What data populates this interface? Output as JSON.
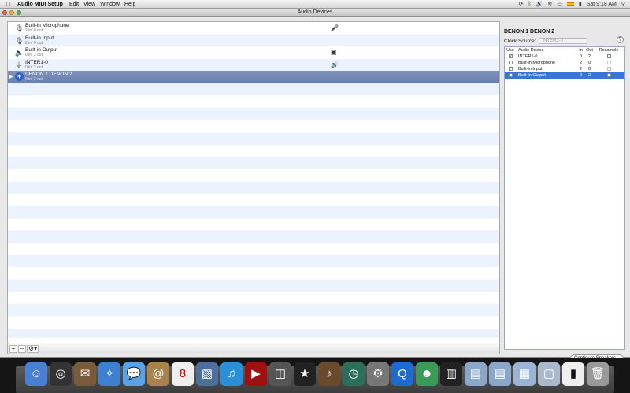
{
  "menubar": {
    "app_name": "Audio MIDI Setup",
    "menus": [
      "Edit",
      "View",
      "Window",
      "Help"
    ],
    "clock": "Sat 9:18 AM"
  },
  "window": {
    "title": "Audio Devices"
  },
  "devices": [
    {
      "name": "Built-in Microphone",
      "io": "2 in/ 0 out",
      "icon": "microphone-device-icon",
      "activity": "microphone-icon"
    },
    {
      "name": "Built-in Input",
      "io": "2 in/ 0 out",
      "icon": "microphone-device-icon",
      "activity": ""
    },
    {
      "name": "Built-in Output",
      "io": "0 in/ 2 out",
      "icon": "speaker-device-icon",
      "activity": "screen-icon"
    },
    {
      "name": "INTER1-0",
      "io": "0 in/ 2 out",
      "icon": "usb-device-icon",
      "activity": "speaker-icon"
    },
    {
      "name": "DENON 1 DENON 2",
      "io": "0 in/ 2 out",
      "icon": "aggregate-device-icon",
      "activity": ""
    }
  ],
  "footer": {
    "add": "+",
    "remove": "−",
    "gear": "⚙▾"
  },
  "detail": {
    "device_name": "DENON 1 DENON 2",
    "clock_source_label": "Clock Source:",
    "clock_source_value": "INTER1-0",
    "help": "?",
    "columns": [
      "Use",
      "Audio Device",
      "In",
      "Out",
      "Resample"
    ],
    "rows": [
      {
        "use": true,
        "device": "INTER1-0",
        "in": "0",
        "out": "2",
        "resample": false
      },
      {
        "use": false,
        "device": "Built-in Microphone",
        "in": "2",
        "out": "0",
        "resample": false
      },
      {
        "use": false,
        "device": "Built-in Input",
        "in": "2",
        "out": "0",
        "resample": false
      },
      {
        "use": false,
        "device": "Built-in Output",
        "in": "0",
        "out": "2",
        "resample": false
      }
    ],
    "configure_button": "Configure Speakers..."
  },
  "dock": {
    "items": [
      "finder-icon",
      "dashboard-icon",
      "mail-icon",
      "safari-icon",
      "ichat-icon",
      "address-book-icon",
      "ical-icon",
      "iphoto-icon",
      "itunes-icon",
      "dvd-player-icon",
      "photo-booth-icon",
      "imovie-icon",
      "garageband-icon",
      "time-machine-icon",
      "system-preferences-icon",
      "quicktime-icon",
      "messenger-icon",
      "piano-icon",
      "applications-folder-icon",
      "documents-folder-icon",
      "downloads-stack-icon",
      "window-icon",
      "terminal-icon",
      "trash-icon"
    ]
  }
}
